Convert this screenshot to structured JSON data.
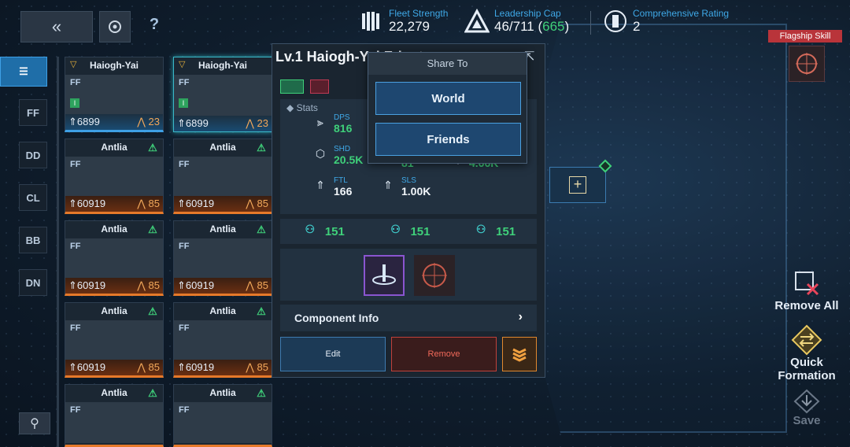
{
  "topbar": {
    "back_icon": "double-chevron-left-icon",
    "refresh_icon": "refresh-icon",
    "help_label": "?",
    "fleet_strength": {
      "label": "Fleet Strength",
      "value": "22,279"
    },
    "leadership_cap": {
      "label": "Leadership Cap",
      "value_main": "46/711 (",
      "value_green": "665",
      "value_end": ")"
    },
    "rating": {
      "label": "Comprehensive Rating",
      "value": "2"
    }
  },
  "flagship_skill": {
    "label": "Flagship Skill"
  },
  "left_nav": [
    {
      "label": "☰",
      "active": true
    },
    {
      "label": "FF"
    },
    {
      "label": "DD"
    },
    {
      "label": "CL"
    },
    {
      "label": "BB"
    },
    {
      "label": "DN"
    }
  ],
  "ships": [
    {
      "name": "Haiogh-Yai",
      "power": "6899",
      "level": "23",
      "style": "blue"
    },
    {
      "name": "Haiogh-Yai",
      "power": "6899",
      "level": "23",
      "style": "blue selected"
    },
    {
      "name": "Antlia",
      "power": "60919",
      "level": "85",
      "style": "orange"
    },
    {
      "name": "Antlia",
      "power": "60919",
      "level": "85",
      "style": "orange"
    },
    {
      "name": "Antlia",
      "power": "60919",
      "level": "85",
      "style": "orange"
    },
    {
      "name": "Antlia",
      "power": "60919",
      "level": "85",
      "style": "orange"
    },
    {
      "name": "Antlia",
      "power": "60919",
      "level": "85",
      "style": "orange"
    },
    {
      "name": "Antlia",
      "power": "60919",
      "level": "85",
      "style": "orange"
    },
    {
      "name": "Antlia",
      "power": "",
      "level": "",
      "style": "orange"
    },
    {
      "name": "Antlia",
      "power": "",
      "level": "",
      "style": "orange"
    }
  ],
  "detail": {
    "title": "Lv.1 Haiogh-Yai Frigate",
    "stats_header": "Stats",
    "stats": {
      "dps": {
        "key": "DPS",
        "value": "816"
      },
      "shd": {
        "key": "SHD",
        "value": "20.5K"
      },
      "armor_value": "81",
      "hp_value": "4.66K",
      "ftl": {
        "key": "FTL",
        "value": "166"
      },
      "sls": {
        "key": "SLS",
        "value": "1.00K"
      }
    },
    "attrs": [
      "151",
      "151",
      "151"
    ],
    "component_info": "Component Info",
    "chevron": "›",
    "edit": "Edit",
    "remove": "Remove"
  },
  "share": {
    "header": "Share To",
    "world": "World",
    "friends": "Friends"
  },
  "right_actions": {
    "remove_all": "Remove All",
    "quick_formation_1": "Quick",
    "quick_formation_2": "Formation",
    "save": "Save"
  }
}
